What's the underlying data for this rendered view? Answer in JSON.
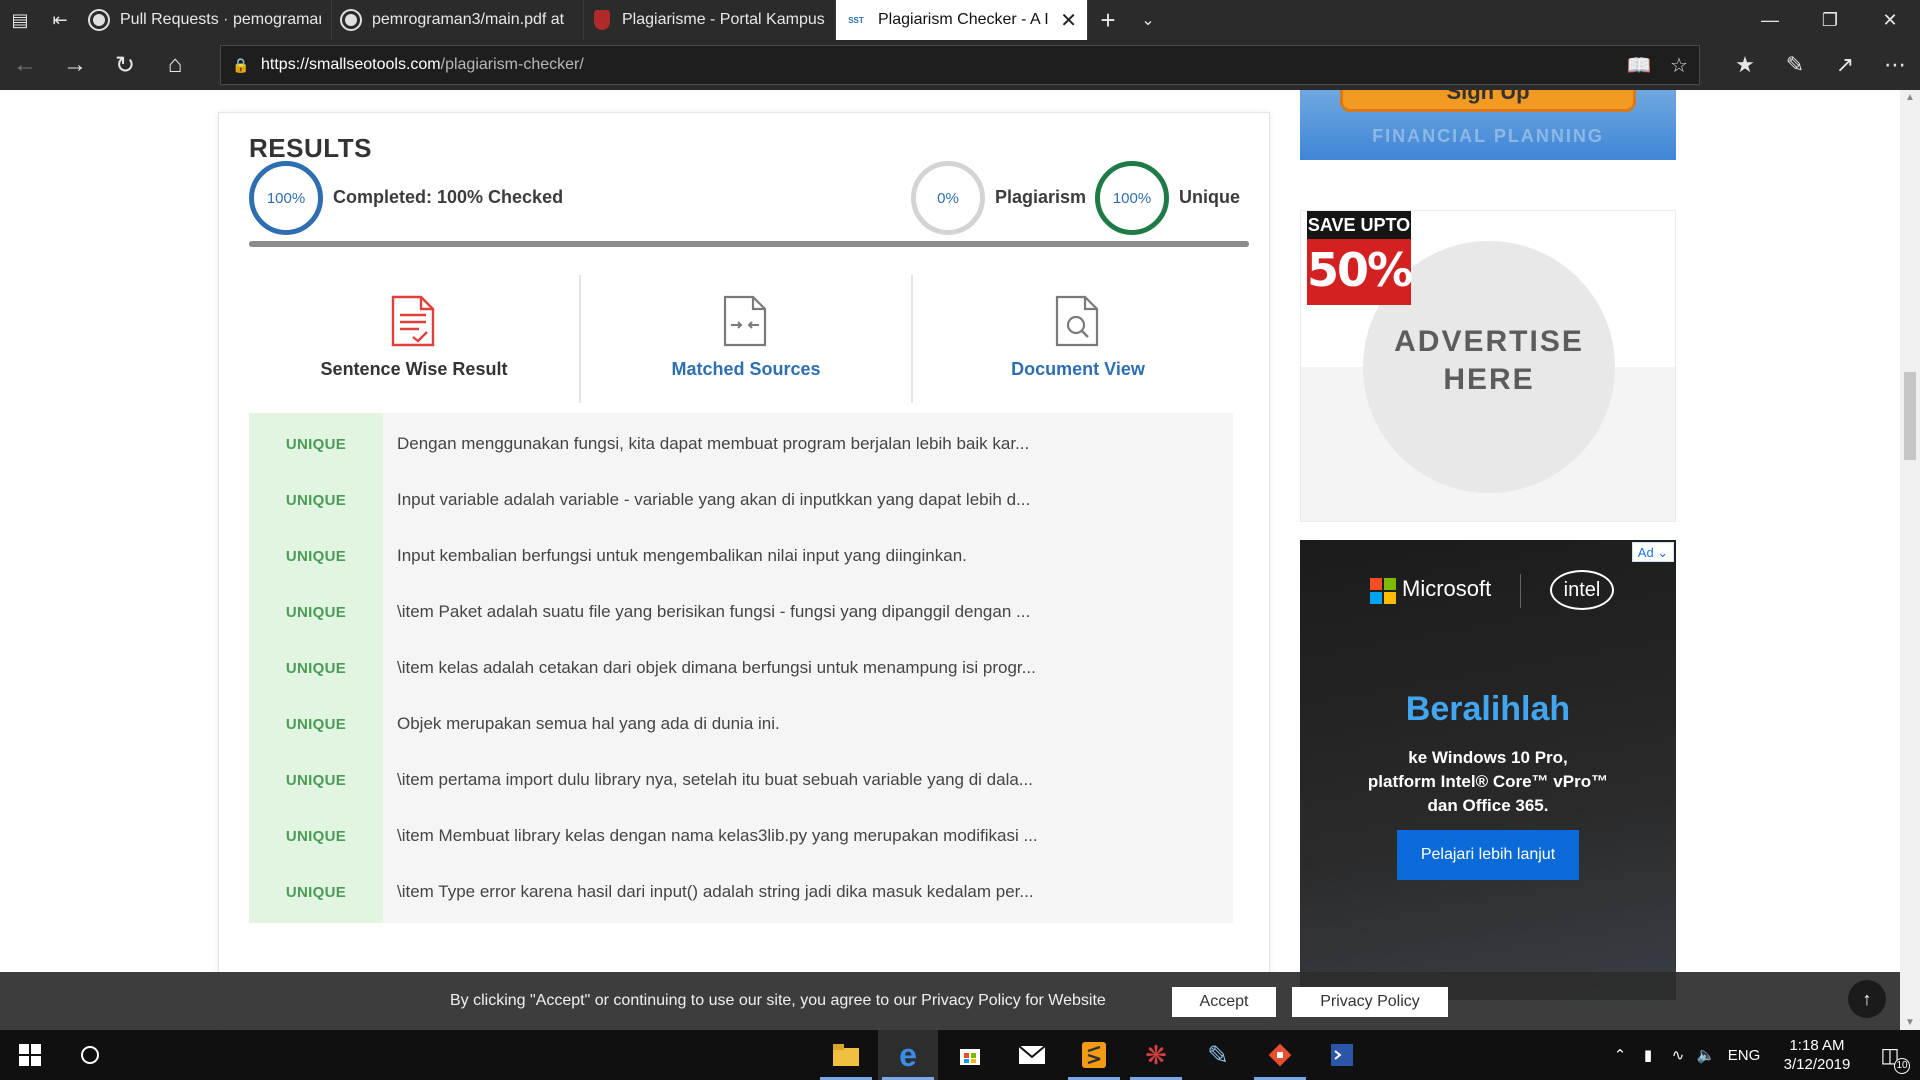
{
  "browser": {
    "tabs": [
      {
        "title": "Pull Requests · pemograman",
        "favicon": "github-icon",
        "active": false
      },
      {
        "title": "pemrograman3/main.pdf at",
        "favicon": "github-icon",
        "active": false
      },
      {
        "title": "Plagiarisme - Portal Kampus",
        "favicon": "shield-icon",
        "active": false
      },
      {
        "title": "Plagiarism Checker - A I",
        "favicon": "sst-icon",
        "active": true
      }
    ],
    "url_host": "https://smallseotools.com",
    "url_path": "/plagiarism-checker/"
  },
  "results": {
    "title": "RESULTS",
    "completed_percent": "100%",
    "completed_label": "Completed: 100% Checked",
    "plagiarism_percent": "0%",
    "plagiarism_label": "Plagiarism",
    "unique_percent": "100%",
    "unique_label": "Unique",
    "progress": 1.0
  },
  "result_tabs": [
    {
      "label": "Sentence Wise Result",
      "color": "#333333"
    },
    {
      "label": "Matched Sources",
      "color": "#2d6fb0"
    },
    {
      "label": "Document View",
      "color": "#2d6fb0"
    }
  ],
  "sentences": [
    {
      "badge": "UNIQUE",
      "text": "Dengan menggunakan fungsi, kita dapat membuat program berjalan lebih baik kar..."
    },
    {
      "badge": "UNIQUE",
      "text": "Input variable adalah variable - variable yang akan di inputkkan yang dapat lebih d..."
    },
    {
      "badge": "UNIQUE",
      "text": "Input kembalian berfungsi untuk mengembalikan nilai input yang diinginkan."
    },
    {
      "badge": "UNIQUE",
      "text": "\\item Paket adalah suatu file yang berisikan fungsi - fungsi yang dipanggil dengan ..."
    },
    {
      "badge": "UNIQUE",
      "text": "\\item kelas adalah cetakan dari objek dimana berfungsi untuk menampung isi progr..."
    },
    {
      "badge": "UNIQUE",
      "text": "Objek merupakan semua hal yang ada di dunia ini."
    },
    {
      "badge": "UNIQUE",
      "text": "\\item pertama import dulu library nya, setelah itu buat sebuah variable yang di dala..."
    },
    {
      "badge": "UNIQUE",
      "text": "\\item Membuat library kelas dengan nama kelas3lib.py yang merupakan modifikasi ..."
    },
    {
      "badge": "UNIQUE",
      "text": "\\item Type error karena hasil dari input() adalah string jadi dika masuk kedalam per..."
    }
  ],
  "ads": {
    "signup_label": "Sign Up",
    "financial_text": "FINANCIAL PLANNING",
    "save_top": "SAVE UPTO",
    "save_big": "50%",
    "advertise": "ADVERTISE HERE",
    "ad_badge": "Ad",
    "ms_text": "Microsoft",
    "intel_text": "intel",
    "headline": "Beralihlah",
    "body_line1": "ke Windows 10 Pro,",
    "body_line2": "platform Intel® Core™ vPro™",
    "body_line3": "dan Office 365.",
    "cta": "Pelajari lebih lanjut"
  },
  "cookie": {
    "message": "By clicking \"Accept\" or continuing to use our site, you agree to our Privacy Policy for Website",
    "accept": "Accept",
    "privacy": "Privacy Policy"
  },
  "taskbar": {
    "language": "ENG",
    "time": "1:18 AM",
    "date": "3/12/2019",
    "notifications": "10"
  },
  "colors": {
    "accent_blue": "#2d6fb0",
    "unique_green": "#1e7b46",
    "badge_bg": "#e2f5e1",
    "badge_text": "#4c9b58"
  }
}
